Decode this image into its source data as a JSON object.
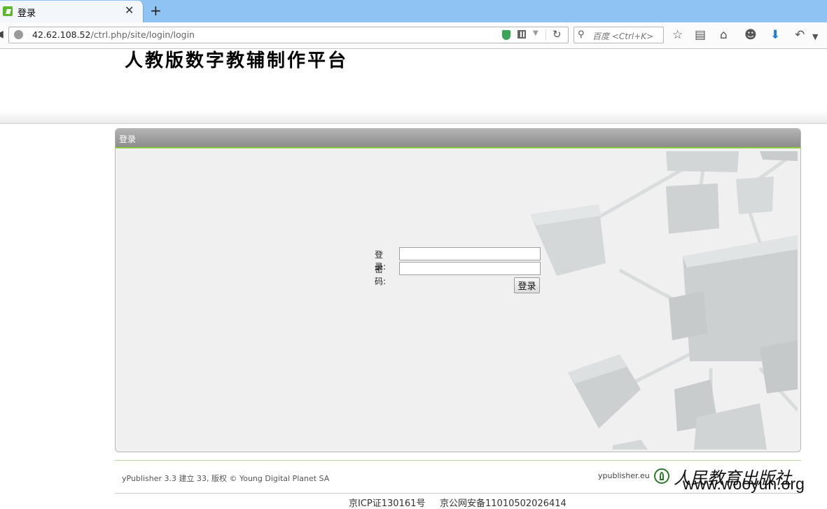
{
  "browser": {
    "tab_title": "登录",
    "url_host": "42.62.108.52",
    "url_path": "/ctrl.php/site/login/login",
    "search_placeholder": "百度 <Ctrl+K>",
    "icons": [
      "back-arrow",
      "globe",
      "shield",
      "qr-code",
      "dropdown",
      "reload",
      "search",
      "star",
      "reading-list",
      "home",
      "chat",
      "download",
      "undo",
      "menu"
    ],
    "accent_tab_bar": "#8fc3f3"
  },
  "page": {
    "site_title": "人教版数字教辅制作平台",
    "panel_title": "登录",
    "form": {
      "login_label": "登录:",
      "login_value": "",
      "password_label": "密码:",
      "password_value": "",
      "submit_label": "登录"
    },
    "accent_green": "#8ccc3c"
  },
  "footer": {
    "copyright": "yPublisher 3.3 建立 33, 版权 © Young Digital Planet SA",
    "link": "ypublisher.eu",
    "logo_text": "人民教育出版社",
    "watermark": "www.wooyun.org",
    "icp": "京ICP证130161号",
    "police": "京公网安备11010502026414"
  }
}
